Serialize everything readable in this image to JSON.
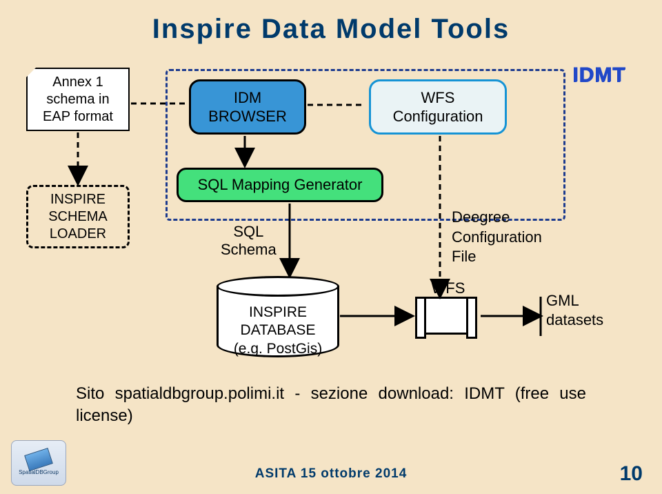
{
  "title": "Inspire Data Model Tools",
  "annex": "Annex 1\nschema in\nEAP format",
  "idmt_label": "IDMT",
  "idm_browser": "IDM\nBROWSER",
  "wfs_config": "WFS\nConfiguration",
  "sql_mapping": "SQL Mapping Generator",
  "schema_loader": "INSPIRE\nSCHEMA\nLOADER",
  "sql_schema": "SQL\nSchema",
  "deegree": "Deegree\nConfiguration\nFile",
  "database": "INSPIRE\nDATABASE\n(e.g. PostGis)",
  "wfs": "WFS",
  "gml": "GML\ndatasets",
  "caption": "Sito spatialdbgroup.polimi.it - sezione download: IDMT (free use license)",
  "footer": "ASITA 15 ottobre 2014",
  "page": "10",
  "logo": "SpatialDBGroup"
}
